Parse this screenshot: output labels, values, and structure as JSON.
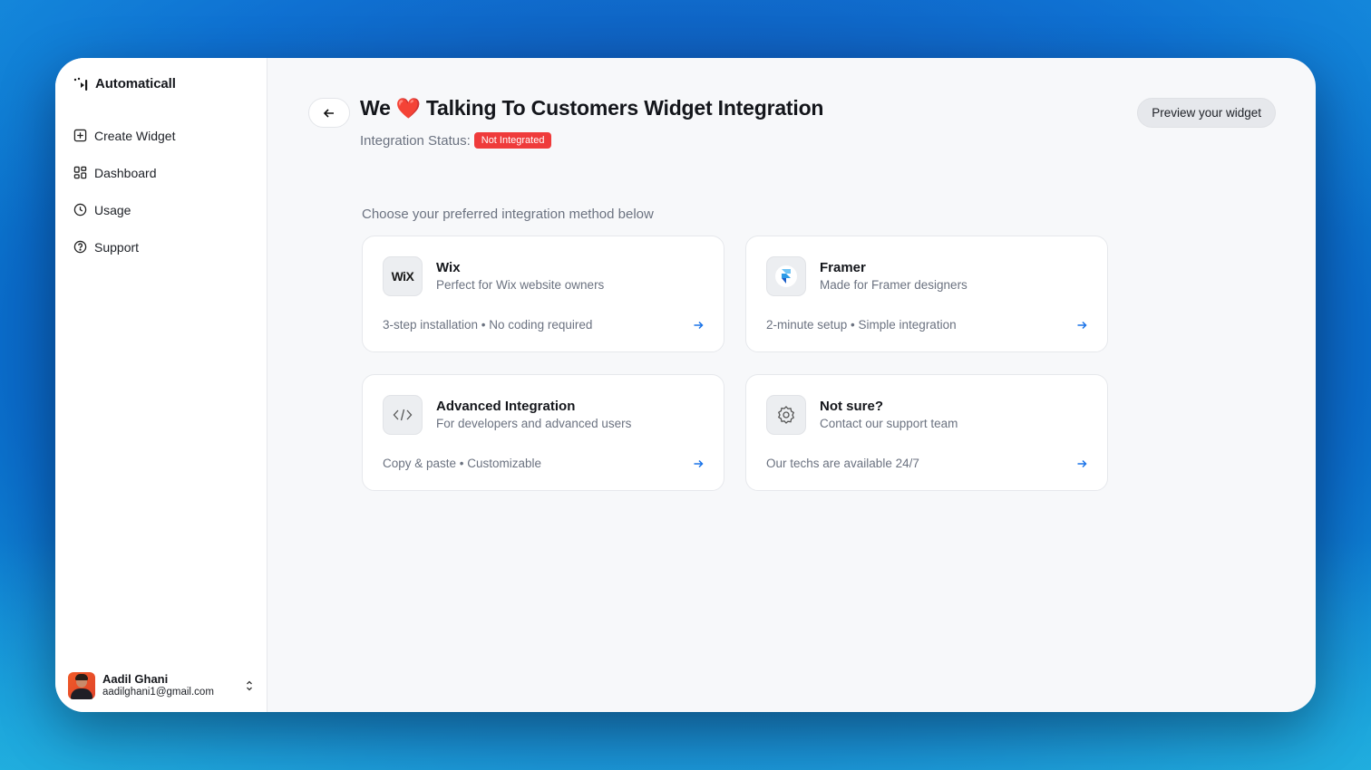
{
  "app": {
    "name": "Automaticall"
  },
  "sidebar": {
    "items": [
      {
        "label": "Create Widget",
        "icon": "plus-square-icon"
      },
      {
        "label": "Dashboard",
        "icon": "grid-icon"
      },
      {
        "label": "Usage",
        "icon": "clock-icon"
      },
      {
        "label": "Support",
        "icon": "help-circle-icon"
      }
    ]
  },
  "user": {
    "name": "Aadil Ghani",
    "email": "aadilghani1@gmail.com"
  },
  "header": {
    "title_prefix": "We",
    "heart": "❤️",
    "title_suffix": "Talking To Customers Widget Integration",
    "status_label": "Integration Status:",
    "status_value": "Not Integrated",
    "preview_button": "Preview your widget"
  },
  "main": {
    "subtitle": "Choose your preferred integration method below",
    "cards": [
      {
        "title": "Wix",
        "desc": "Perfect for Wix website owners",
        "meta": "3-step installation • No coding required",
        "icon": "wix-logo",
        "icon_text": "WiX"
      },
      {
        "title": "Framer",
        "desc": "Made for Framer designers",
        "meta": "2-minute setup • Simple integration",
        "icon": "framer-logo"
      },
      {
        "title": "Advanced Integration",
        "desc": "For developers and advanced users",
        "meta": "Copy & paste • Customizable",
        "icon": "code-icon"
      },
      {
        "title": "Not sure?",
        "desc": "Contact our support team",
        "meta": "Our techs are available 24/7",
        "icon": "support-gear-icon"
      }
    ]
  },
  "colors": {
    "accent": "#1a73e8",
    "status_bad": "#ef3b3b"
  }
}
